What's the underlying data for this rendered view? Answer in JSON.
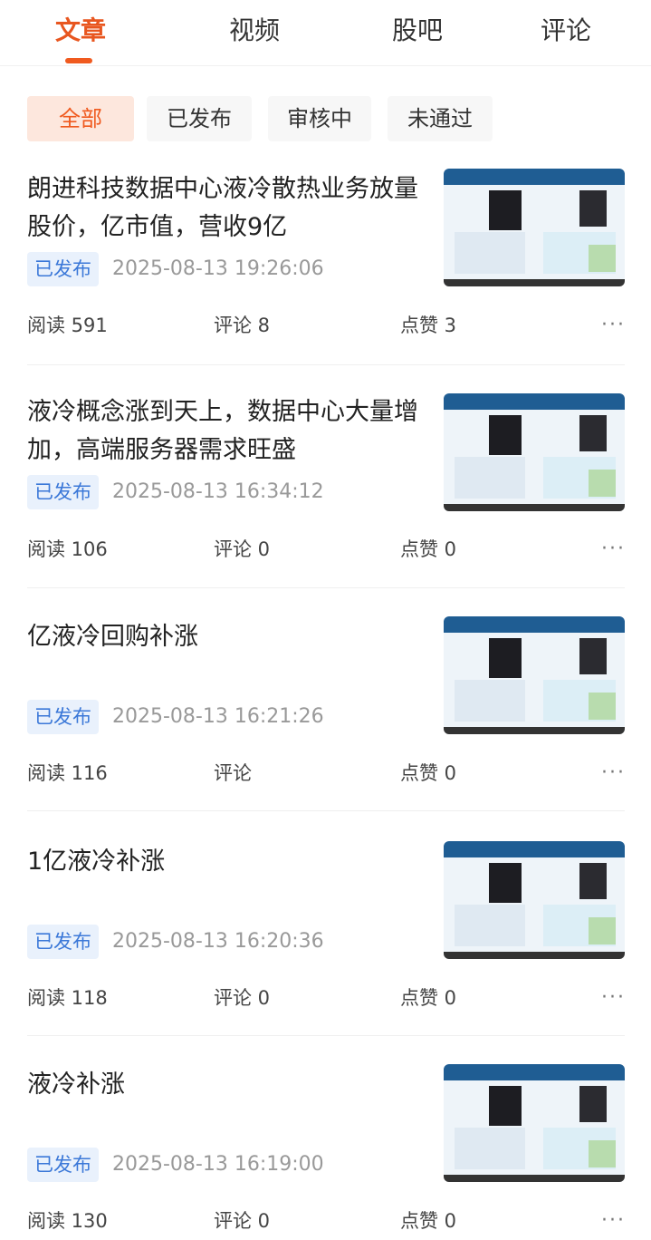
{
  "tabs": [
    {
      "label": "文章",
      "active": true
    },
    {
      "label": "视频"
    },
    {
      "label": "股吧"
    },
    {
      "label": "评论"
    }
  ],
  "filters": [
    {
      "label": "全部",
      "active": true
    },
    {
      "label": "已发布"
    },
    {
      "label": "审核中"
    },
    {
      "label": "未通过"
    }
  ],
  "articles": [
    {
      "title": "朗进科技数据中心液冷散热业务放量股价，亿市值，营收9亿",
      "status": "已发布",
      "time": "2025-08-13 19:26:06",
      "reads_label": "阅读 591",
      "comments_label": "评论 8",
      "likes_label": "点赞 3"
    },
    {
      "title": "液冷概念涨到天上，数据中心大量增加，高端服务器需求旺盛",
      "status": "已发布",
      "time": "2025-08-13 16:34:12",
      "reads_label": "阅读 106",
      "comments_label": "评论 0",
      "likes_label": "点赞 0"
    },
    {
      "title": "亿液冷回购补涨",
      "status": "已发布",
      "time": "2025-08-13 16:21:26",
      "reads_label": "阅读 116",
      "comments_label": "评论",
      "likes_label": "点赞 0"
    },
    {
      "title": "1亿液冷补涨",
      "status": "已发布",
      "time": "2025-08-13 16:20:36",
      "reads_label": "阅读 118",
      "comments_label": "评论 0",
      "likes_label": "点赞 0"
    },
    {
      "title": "液冷补涨",
      "status": "已发布",
      "time": "2025-08-13 16:19:00",
      "reads_label": "阅读 130",
      "comments_label": "评论 0",
      "likes_label": "点赞 0"
    }
  ],
  "icons": {
    "more": "more-dots-icon"
  },
  "colors": {
    "accent": "#f05a1f",
    "badge_text": "#3b78d8",
    "badge_bg": "#e9f1fc"
  }
}
